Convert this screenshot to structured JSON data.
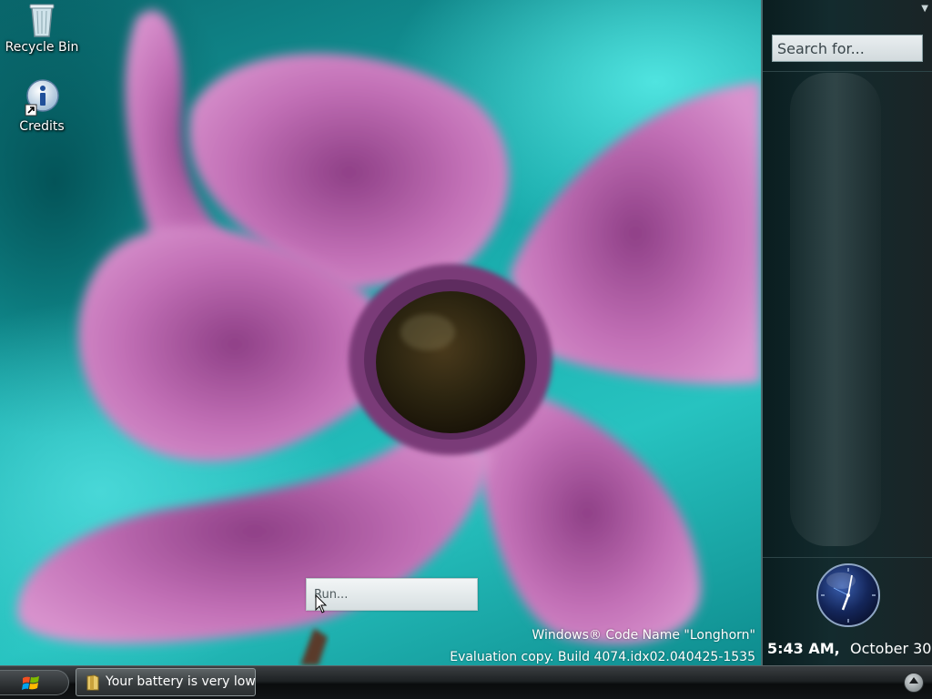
{
  "desktop": {
    "icons": [
      {
        "label": "Recycle Bin",
        "icon": "recycle-bin-icon"
      },
      {
        "label": "Credits",
        "icon": "info-shortcut-icon"
      }
    ]
  },
  "sidebar": {
    "search": {
      "placeholder": "Search for..."
    },
    "clock": {
      "time": "5:43 AM,",
      "date": "October 30",
      "icon": "analog-clock-icon"
    }
  },
  "run_box": {
    "text": "Run..."
  },
  "watermark": {
    "line1": "Windows® Code Name \"Longhorn\"",
    "line2": "Evaluation copy. Build 4074.idx02.040425-1535"
  },
  "taskbar": {
    "start_icon": "windows-flag-icon",
    "tasks": [
      {
        "label": "Your battery is very low",
        "icon": "battery-folder-icon"
      }
    ],
    "tray_expand_icon": "chevron-up-icon"
  },
  "colors": {
    "wallpaper_teal": "#16a7a8",
    "flower_pink": "#c56bb8",
    "sidebar_bg": "#132b2e",
    "taskbar_bg": "#1e2224"
  }
}
